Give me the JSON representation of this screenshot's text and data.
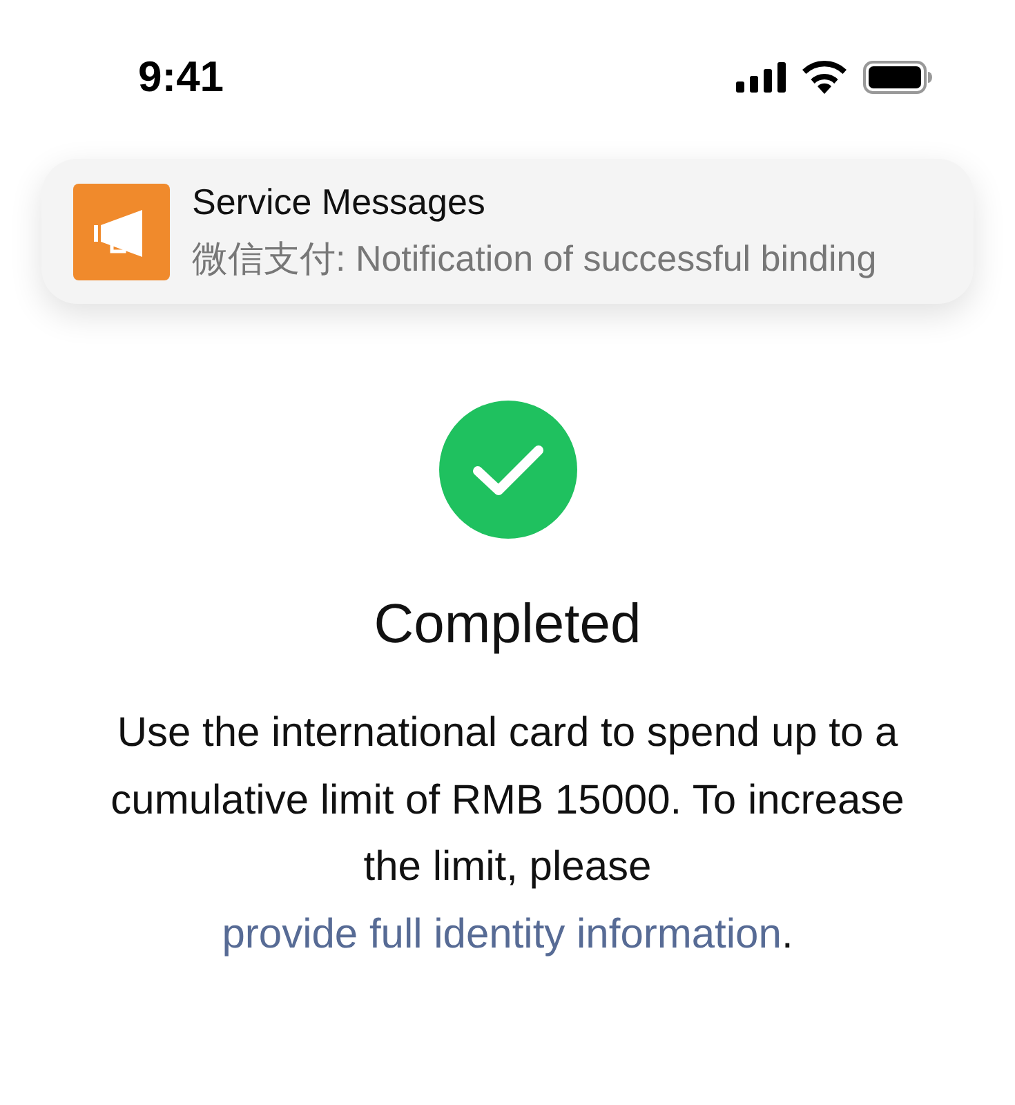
{
  "status_bar": {
    "time": "9:41"
  },
  "notification": {
    "title": "Service Messages",
    "message": "微信支付: Notification of successful binding"
  },
  "result": {
    "title": "Completed",
    "text": "Use the international card to spend up to a cumulative limit of RMB 15000. To increase the limit, please ",
    "link": "provide full identity information",
    "end": "."
  }
}
